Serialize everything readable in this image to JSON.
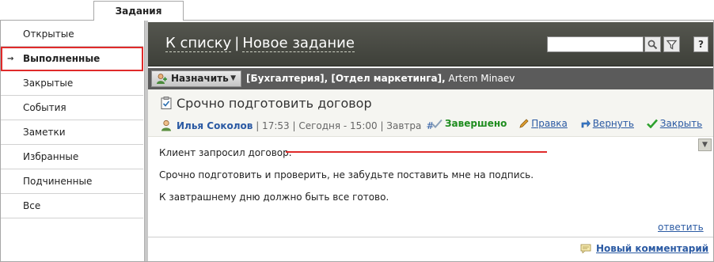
{
  "top_tab": "Задания",
  "sidebar": {
    "items": [
      {
        "label": "Открытые"
      },
      {
        "label": "Выполненные",
        "active": true
      },
      {
        "label": "Закрытые"
      },
      {
        "label": "События"
      },
      {
        "label": "Заметки"
      },
      {
        "label": "Избранные"
      },
      {
        "label": "Подчиненные"
      },
      {
        "label": "Все"
      }
    ]
  },
  "header": {
    "back_link": "К списку",
    "separator": "|",
    "new_task_link": "Новое задание",
    "help_label": "?"
  },
  "assign": {
    "button_label": "Назначить",
    "departments": "[Бухгалтерия], [Отдел маркетинга],",
    "person": "Artem Minaev"
  },
  "task": {
    "title": "Срочно подготовить договор",
    "author": "Илья Соколов",
    "meta": "| 17:53 | Сегодня - 15:00 | Завтра",
    "hash": "#",
    "body": [
      "Клиент запросил договор.",
      "Срочно подготовить и проверить, не забудьте поставить мне на подпись.",
      "К завтрашнему дню должно быть все готово."
    ]
  },
  "actions": {
    "status": "Завершено",
    "edit": "Правка",
    "return": "Вернуть",
    "close": "Закрыть"
  },
  "reply_label": "ответить",
  "new_comment_label": "Новый комментарий",
  "colors": {
    "accent_red": "#e02a2a",
    "link_blue": "#2b5aa3",
    "status_green": "#1f8d1f",
    "header_dark": "#4a4b45"
  }
}
